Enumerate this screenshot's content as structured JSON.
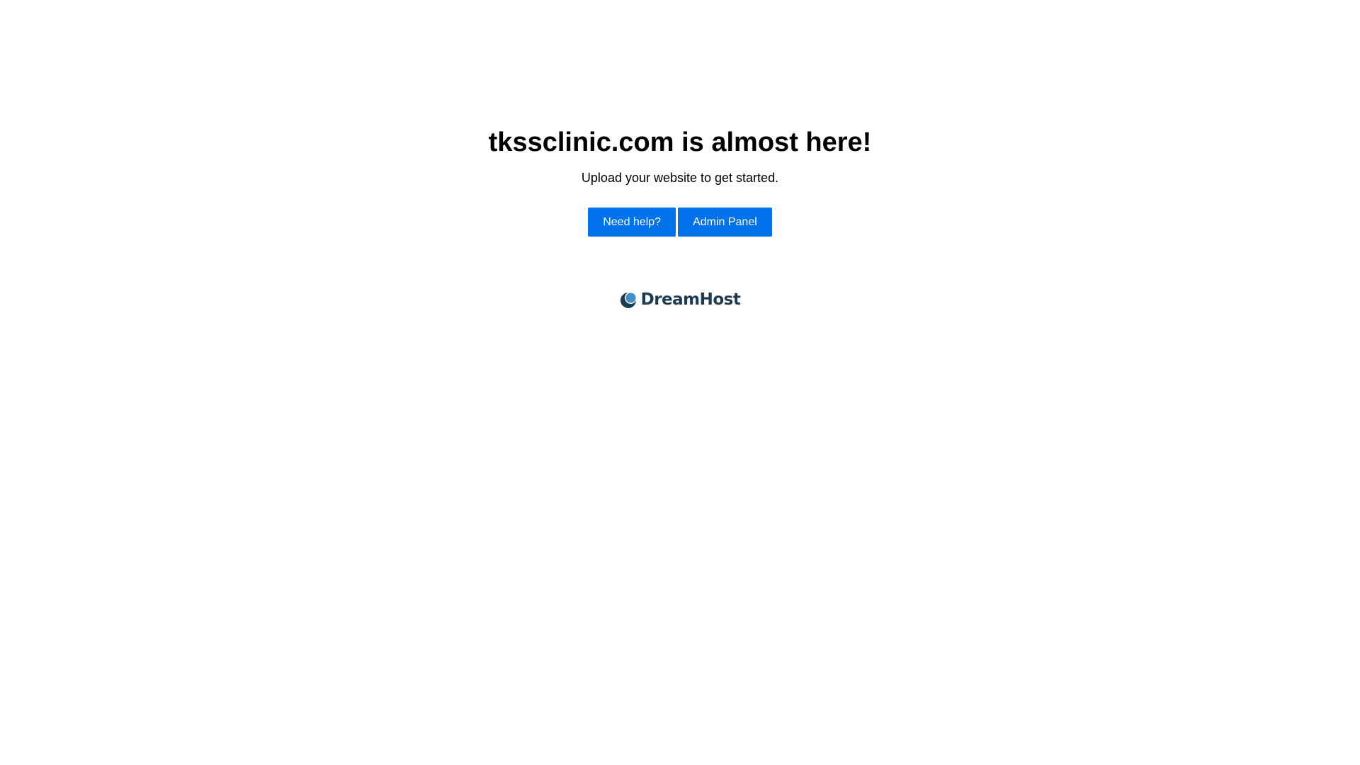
{
  "main": {
    "title": "tkssclinic.com is almost here!",
    "subtitle": "Upload your website to get started.",
    "buttons": {
      "help_label": "Need help?",
      "admin_label": "Admin Panel"
    }
  },
  "logo": {
    "icon": "dreamhost-moon-icon",
    "text": "DreamHost"
  },
  "colors": {
    "button_background": "#0073ec",
    "button_text": "#ffffff",
    "logo_text": "#1c3a52",
    "logo_accent": "#3d8fc4"
  }
}
